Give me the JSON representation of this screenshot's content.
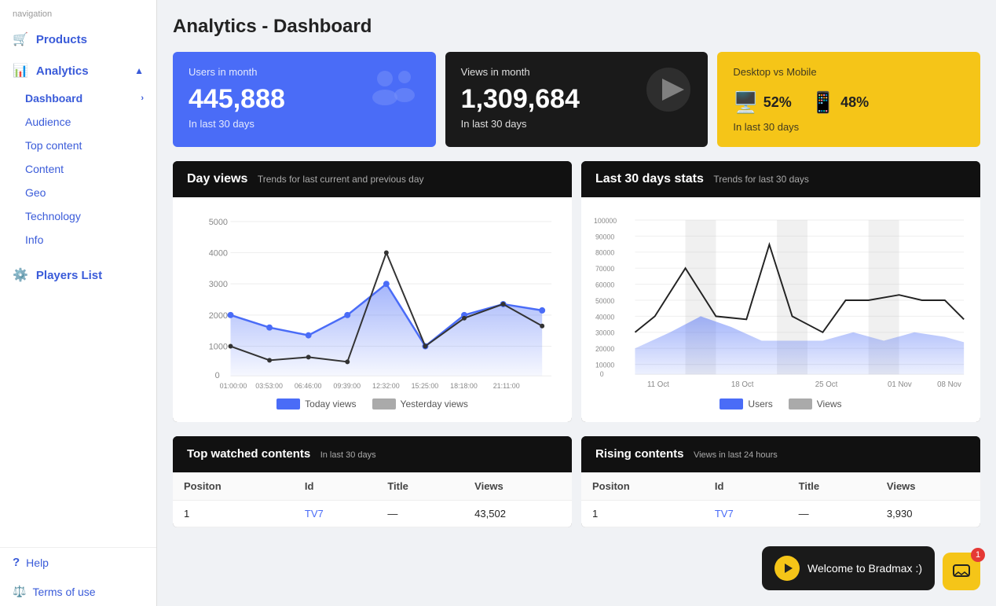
{
  "sidebar": {
    "nav_label": "navigation",
    "items": [
      {
        "id": "products",
        "label": "Products",
        "icon": "🛒"
      },
      {
        "id": "analytics",
        "label": "Analytics",
        "icon": "📊"
      }
    ],
    "analytics_sub": [
      {
        "id": "dashboard",
        "label": "Dashboard",
        "active": true,
        "hasChevron": true
      },
      {
        "id": "audience",
        "label": "Audience"
      },
      {
        "id": "top-content",
        "label": "Top content"
      },
      {
        "id": "content",
        "label": "Content"
      },
      {
        "id": "geo",
        "label": "Geo"
      },
      {
        "id": "technology",
        "label": "Technology"
      },
      {
        "id": "info",
        "label": "Info"
      }
    ],
    "bottom_items": [
      {
        "id": "players-list",
        "label": "Players List",
        "icon": "⚙️"
      }
    ],
    "footer_items": [
      {
        "id": "help",
        "label": "Help",
        "icon": "?"
      },
      {
        "id": "terms",
        "label": "Terms of use",
        "icon": "⚖️"
      }
    ]
  },
  "page": {
    "title": "Analytics - Dashboard"
  },
  "stats": [
    {
      "id": "users-in-month",
      "label": "Users in month",
      "value": "445,888",
      "sub": "In last 30 days",
      "theme": "blue",
      "icon": "👥"
    },
    {
      "id": "views-in-month",
      "label": "Views in month",
      "value": "1,309,684",
      "sub": "In last 30 days",
      "theme": "dark",
      "icon": "▶"
    },
    {
      "id": "desktop-vs-mobile",
      "label": "Desktop vs Mobile",
      "desktop_pct": "52%",
      "mobile_pct": "48%",
      "sub": "In last 30 days",
      "theme": "yellow"
    }
  ],
  "day_views_chart": {
    "title": "Day views",
    "subtitle": "Trends for last current and previous day",
    "legend": [
      {
        "label": "Today views",
        "color": "blue"
      },
      {
        "label": "Yesterday views",
        "color": "gray"
      }
    ],
    "x_labels": [
      "01:00:00",
      "03:53:00",
      "06:46:00",
      "09:39:00",
      "12:32:00",
      "15:25:00",
      "18:18:00",
      "21:11:00"
    ],
    "y_labels": [
      "5000",
      "4000",
      "3000",
      "2000",
      "1000",
      "0"
    ]
  },
  "last30_chart": {
    "title": "Last 30 days stats",
    "subtitle": "Trends for last 30 days",
    "legend": [
      {
        "label": "Users",
        "color": "blue"
      },
      {
        "label": "Views",
        "color": "gray"
      }
    ],
    "x_labels": [
      "11 Oct",
      "18 Oct",
      "25 Oct",
      "01 Nov",
      "08 Nov"
    ],
    "y_labels": [
      "100000",
      "90000",
      "80000",
      "70000",
      "60000",
      "50000",
      "40000",
      "30000",
      "20000",
      "10000",
      "0"
    ]
  },
  "top_watched": {
    "title": "Top watched contents",
    "subtitle": "In last 30 days",
    "columns": [
      "Positon",
      "Id",
      "Title",
      "Views"
    ],
    "rows": [
      {
        "position": "1",
        "id": "TV7",
        "title": "...",
        "views": "43,502"
      }
    ]
  },
  "rising_contents": {
    "title": "Rising contents",
    "subtitle": "Views in last 24 hours",
    "columns": [
      "Positon",
      "Id",
      "Title",
      "Views"
    ],
    "rows": [
      {
        "position": "1",
        "id": "TV7",
        "title": "...",
        "views": "3,930"
      }
    ]
  },
  "chat": {
    "message": "Welcome to Bradmax :)",
    "badge": "1",
    "icon": "chat"
  }
}
